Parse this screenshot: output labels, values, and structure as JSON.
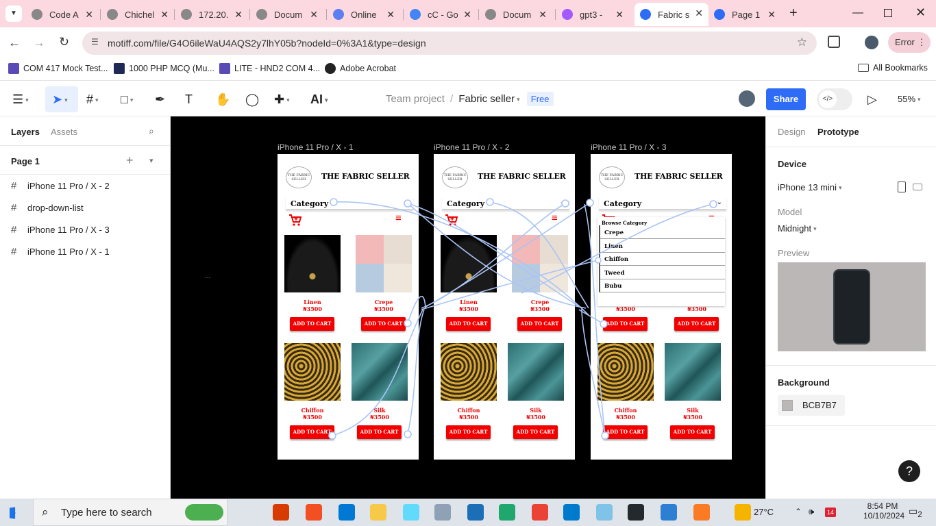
{
  "browser": {
    "tabs": [
      {
        "label": "Code A",
        "color": "#888888"
      },
      {
        "label": "Chichel",
        "color": "#888888"
      },
      {
        "label": "172.20.",
        "color": "#888888"
      },
      {
        "label": "Docum",
        "color": "#888888"
      },
      {
        "label": "Online",
        "color": "#5b7ff1"
      },
      {
        "label": "cC - Go",
        "color": "#4285f4"
      },
      {
        "label": "Docum",
        "color": "#888888"
      },
      {
        "label": "gpt3 -",
        "color": "#a259ff"
      },
      {
        "label": "Fabric s",
        "color": "#2f6cf6"
      },
      {
        "label": "Page 1",
        "color": "#2f6cf6"
      }
    ],
    "url": "motiff.com/file/G4O6ileWaU4AQS2y7lhY05b?nodeId=0%3A1&type=design",
    "error_label": "Error",
    "bookmarks": [
      "COM 417 Mock Test...",
      "1000 PHP MCQ (Mu...",
      "LITE - HND2 COM 4...",
      "Adobe Acrobat"
    ],
    "all_bookmarks": "All Bookmarks"
  },
  "toolbar": {
    "ai_label": "AI",
    "breadcrumb_team": "Team project",
    "breadcrumb_sep": "/",
    "file_name": "Fabric seller",
    "plan_badge": "Free",
    "share_label": "Share",
    "zoom": "55%"
  },
  "left_panel": {
    "tab_layers": "Layers",
    "tab_assets": "Assets",
    "page_name": "Page 1",
    "layers": [
      "iPhone 11 Pro / X - 2",
      "drop-down-list",
      "iPhone 11 Pro / X - 3",
      "iPhone 11 Pro / X - 1"
    ]
  },
  "canvas": {
    "frames": [
      {
        "label": "iPhone 11 Pro / X - 1",
        "dropdown": false
      },
      {
        "label": "iPhone 11 Pro / X - 2",
        "dropdown": false
      },
      {
        "label": "iPhone 11 Pro / X - 3",
        "dropdown": true
      }
    ],
    "brand": "THE FABRIC SELLER",
    "logo_text": "THE FABRIC SELLER",
    "category_label": "Category",
    "products": [
      {
        "name": "Linen",
        "price": "₦3500",
        "image": "necklace"
      },
      {
        "name": "Crepe",
        "price": "₦3500",
        "image": "fabrics"
      },
      {
        "name": "Chiffon",
        "price": "₦3500",
        "image": "chains"
      },
      {
        "name": "Silk",
        "price": "₦3500",
        "image": "silk"
      }
    ],
    "add_to_cart": "ADD TO CART",
    "dropdown_header": "Browse Category",
    "dropdown_items": [
      "Crepe",
      "Linen",
      "Chiffon",
      "Tweed",
      "Bubu"
    ],
    "ellipsis": "..."
  },
  "right_panel": {
    "tab_design": "Design",
    "tab_prototype": "Prototype",
    "device_label": "Device",
    "device_value": "iPhone 13 mini",
    "model_label": "Model",
    "model_value": "Midnight",
    "preview_label": "Preview",
    "background_label": "Background",
    "background_value": "BCB7B7",
    "background_color": "#BCB7B7",
    "help": "?"
  },
  "taskbar": {
    "search_placeholder": "Type here to search",
    "weather": "27°C",
    "time": "8:54 PM",
    "date": "10/10/2024",
    "mail_badge": "14",
    "notif_count": "2"
  }
}
